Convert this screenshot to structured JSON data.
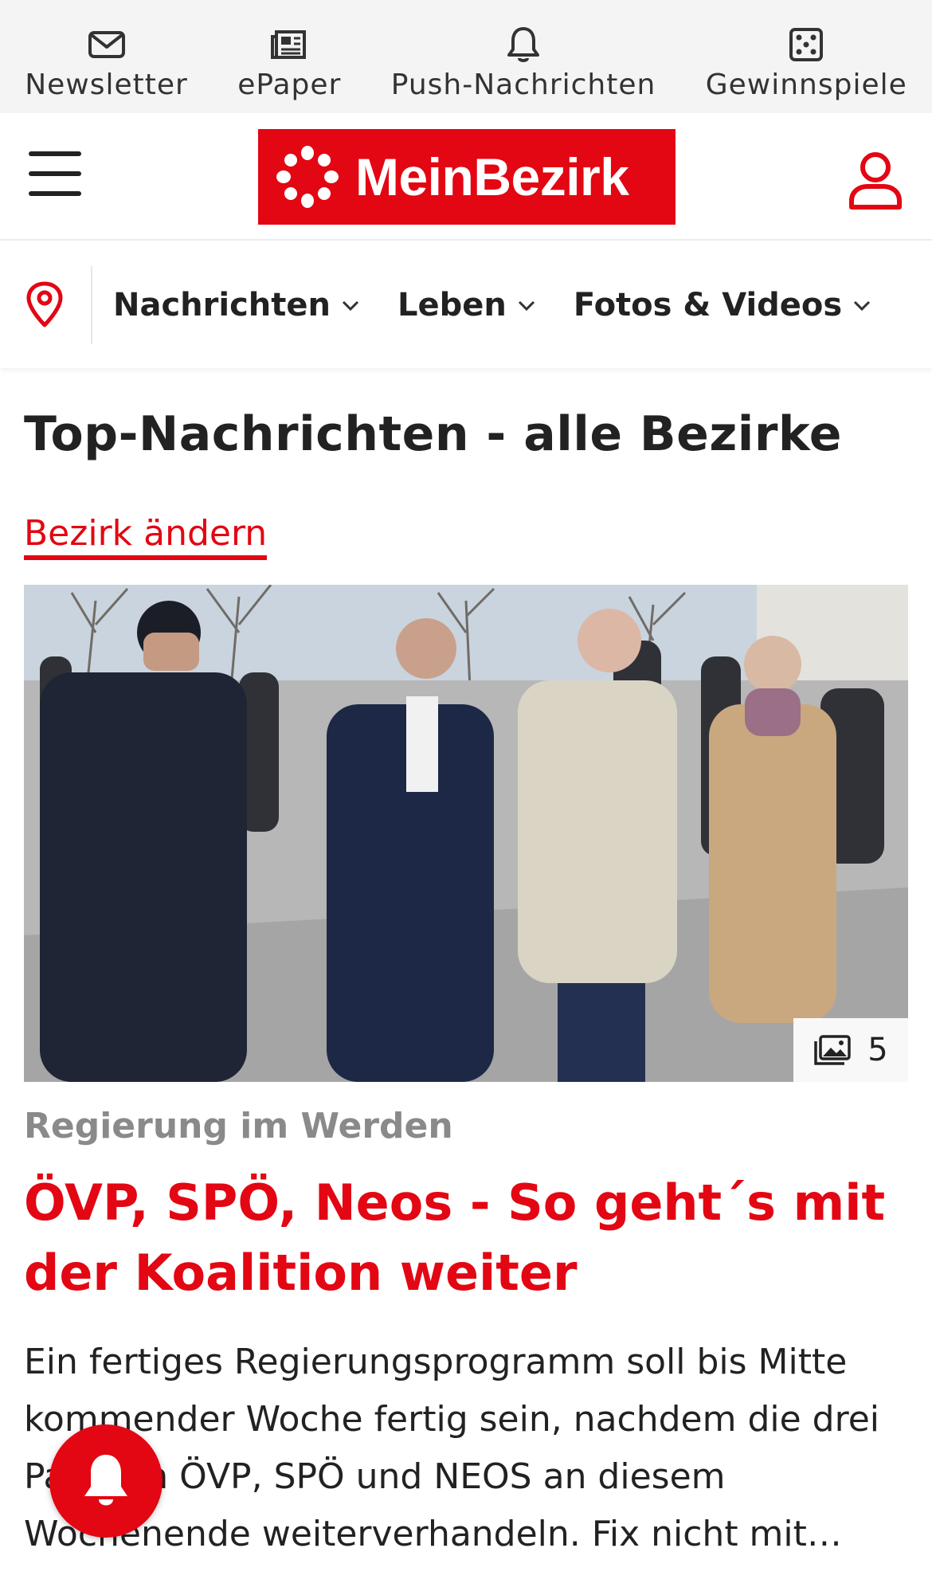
{
  "utility_bar": {
    "items": [
      {
        "label": "Newsletter",
        "icon": "mail-icon"
      },
      {
        "label": "ePaper",
        "icon": "newspaper-icon"
      },
      {
        "label": "Push-Nachrichten",
        "icon": "bell-icon"
      },
      {
        "label": "Gewinnspiele",
        "icon": "dice-icon"
      }
    ]
  },
  "header": {
    "logo_text": "MeinBezirk",
    "brand_color": "#e30613"
  },
  "nav": {
    "items": [
      {
        "label": "Nachrichten"
      },
      {
        "label": "Leben"
      },
      {
        "label": "Fotos & Videos"
      }
    ]
  },
  "main": {
    "heading": "Top-Nachrichten - alle Bezirke",
    "change_district": "Bezirk ändern",
    "article": {
      "image_count": "5",
      "kicker": "Regierung im Werden",
      "title": "ÖVP, SPÖ, Neos - So geht´s mit der Koalition weiter",
      "lead": "Ein fertiges Regierungsprogramm soll bis Mitte kommender Woche fertig sein, nachdem die drei Parteien ÖVP, SPÖ und NEOS an diesem Wochenende weiterverhandeln. Fix nicht mit…"
    }
  }
}
